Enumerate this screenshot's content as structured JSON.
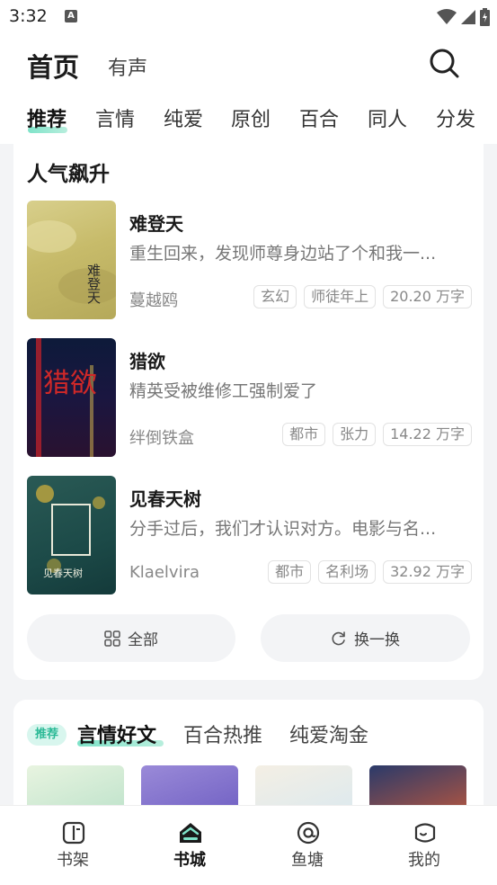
{
  "status": {
    "time": "3:32",
    "notif_letter": "A"
  },
  "header": {
    "title": "首页",
    "subtitle": "有声"
  },
  "categories": [
    "推荐",
    "言情",
    "纯爱",
    "原创",
    "百合",
    "同人",
    "分发"
  ],
  "rising": {
    "title": "人气飙升",
    "books": [
      {
        "title": "难登天",
        "desc": "重生回来，发现师尊身边站了个和我一...",
        "author": "蔓越鸥",
        "tags": [
          "玄幻",
          "师徒年上",
          "20.20 万字"
        ],
        "cover_text": "难登天"
      },
      {
        "title": "猎欲",
        "desc": "精英受被维修工强制爱了",
        "author": "绊倒铁盒",
        "tags": [
          "都市",
          "张力",
          "14.22 万字"
        ],
        "cover_text": "猎欲"
      },
      {
        "title": "见春天树",
        "desc": "分手过后，我们才认识对方。电影与名...",
        "author": "Klaelvira",
        "tags": [
          "都市",
          "名利场",
          "32.92 万字"
        ],
        "cover_text": "见春天树"
      }
    ],
    "btn_all": "全部",
    "btn_refresh": "换一换"
  },
  "section2": {
    "badge": "推荐",
    "tabs": [
      "言情好文",
      "百合热推",
      "纯爱淘金"
    ]
  },
  "nav": [
    "书架",
    "书城",
    "鱼塘",
    "我的"
  ],
  "colors": {
    "accent": "#2bb996",
    "accent_light": "#7fe3c9",
    "background": "#f3f4f6"
  }
}
